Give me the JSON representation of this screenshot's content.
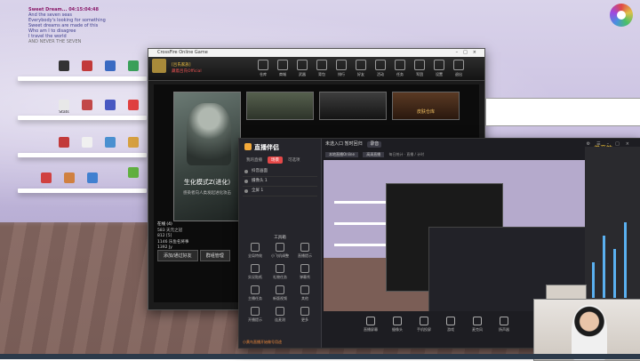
{
  "desktop": {
    "overlay_lines": [
      "Sweet Dream...",
      "And the seven seas",
      "Everybody's looking for something",
      "Sweet dreams are made of this",
      "Who am I to disagree",
      "I travel the world",
      "AND NEVER THE SEVEN"
    ],
    "time_stamp": "04:15:04:48",
    "icons": [
      {
        "label": "",
        "color": "#333333"
      },
      {
        "label": "",
        "color": "#c23a3a"
      },
      {
        "label": "",
        "color": "#3a6ac2"
      },
      {
        "label": "",
        "color": "#3aa05a"
      },
      {
        "label": "Stats",
        "color": "#e8e8e8"
      },
      {
        "label": "",
        "color": "#c24848"
      },
      {
        "label": "",
        "color": "#4858c2"
      },
      {
        "label": "",
        "color": "#e04040"
      },
      {
        "label": "",
        "color": "#c23a3a"
      },
      {
        "label": "",
        "color": "#f0f0f0"
      },
      {
        "label": "",
        "color": "#4a90d0"
      },
      {
        "label": "",
        "color": "#d6a040"
      },
      {
        "label": "",
        "color": "#d04040"
      },
      {
        "label": "",
        "color": "#d08040"
      },
      {
        "label": "",
        "color": "#4080d0"
      },
      {
        "label": "",
        "color": "#60b040"
      }
    ]
  },
  "cf_window": {
    "title": "CrossFire Online Game",
    "profile_name": "藏着吕氏Official",
    "profile_tag": "[吕氏家族]",
    "nav": [
      "仓库",
      "商城",
      "武器",
      "背包",
      "排行",
      "好友",
      "活动",
      "任务",
      "军团",
      "设置",
      "退出"
    ],
    "banner_title": "生化模式Z(进化)",
    "banner_sub": "感染者向人类发起进化攻击",
    "thumb_right_label": "皮肤仓库",
    "list_header_1": "在线 (4)",
    "list_header_2": "离线 (118)",
    "list_items": [
      "583 天元之冠",
      "812 [5]",
      "1146 乐鱼名将事",
      "1392 Jy"
    ],
    "btn_add": "添加/通过好友",
    "btn_group": "群组管理"
  },
  "streaming_app": {
    "logo": "直播伴侣",
    "tabs": [
      "我的直播",
      "场景",
      "可选项"
    ],
    "scenes": [
      "抖音画面",
      "摄像头 1",
      "全屏 1"
    ],
    "tools_header": "工具箱",
    "tools": [
      "全局特效",
      "小飞机调整",
      "直播提示",
      "实况贴纸",
      "礼物任务",
      "弹幕秀",
      "主播任务",
      "新版视频",
      "其他",
      "开播提示",
      "连麦测",
      "更多"
    ],
    "notice": "小黄鸟直播开始做号用途",
    "head_title": "未选入口 暂时回归",
    "head_badge": "录音",
    "info_tags": [
      "本地直播Online",
      "高清直播"
    ],
    "info_text": "每日统计 · 直播 / 计时",
    "bottom": [
      "直播屏幕",
      "摄像头",
      "手机投屏",
      "游戏",
      "麦克风",
      "扬声器"
    ],
    "right_text": "弟音韵"
  }
}
